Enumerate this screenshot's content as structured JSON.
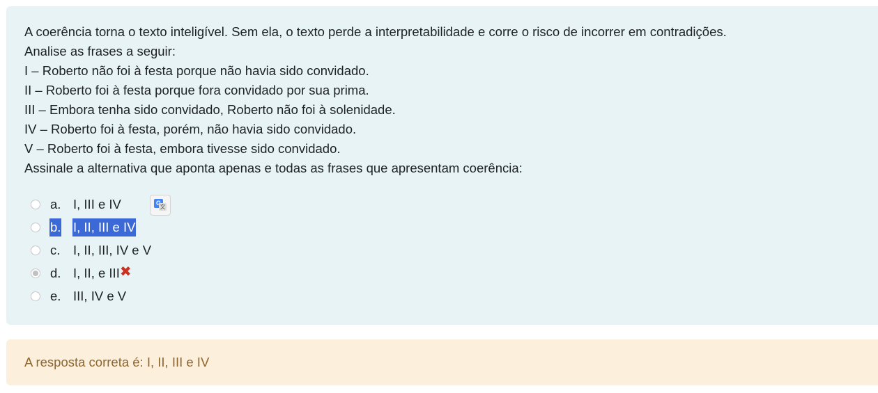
{
  "question": {
    "lines": [
      "A coerência torna o texto inteligível. Sem ela, o texto perde a interpretabilidade e corre o risco de incorrer em contradições.",
      "Analise as frases a seguir:",
      "I – Roberto não foi à festa porque não havia sido convidado.",
      "II – Roberto foi à festa porque fora convidado por sua prima.",
      "III – Embora tenha sido convidado, Roberto não foi à solenidade.",
      "IV – Roberto foi à festa, porém, não havia sido convidado.",
      "V – Roberto foi à festa, embora tivesse sido convidado.",
      "Assinale a alternativa que aponta apenas e todas as frases que apresentam coerência:"
    ]
  },
  "answers": [
    {
      "letter": "a.",
      "text": "I, III e IV",
      "checked": false
    },
    {
      "letter": "b.",
      "text": "I, II, III e IV",
      "checked": false,
      "highlighted": true
    },
    {
      "letter": "c.",
      "text": "I, II, III, IV e V",
      "checked": false
    },
    {
      "letter": "d.",
      "text": "I, II, e III",
      "checked": true,
      "incorrect": true
    },
    {
      "letter": "e.",
      "text": "III, IV e V",
      "checked": false
    }
  ],
  "icons": {
    "translate": "google-translate-icon",
    "incorrect": "red-x-icon"
  },
  "feedback": {
    "text": "A resposta correta é: I, II, III e IV"
  },
  "colors": {
    "question_bg": "#e7f3f5",
    "feedback_bg": "#fcefdc",
    "feedback_text": "#8e662e",
    "highlight": "#3b69d8",
    "incorrect": "#ca3120"
  }
}
